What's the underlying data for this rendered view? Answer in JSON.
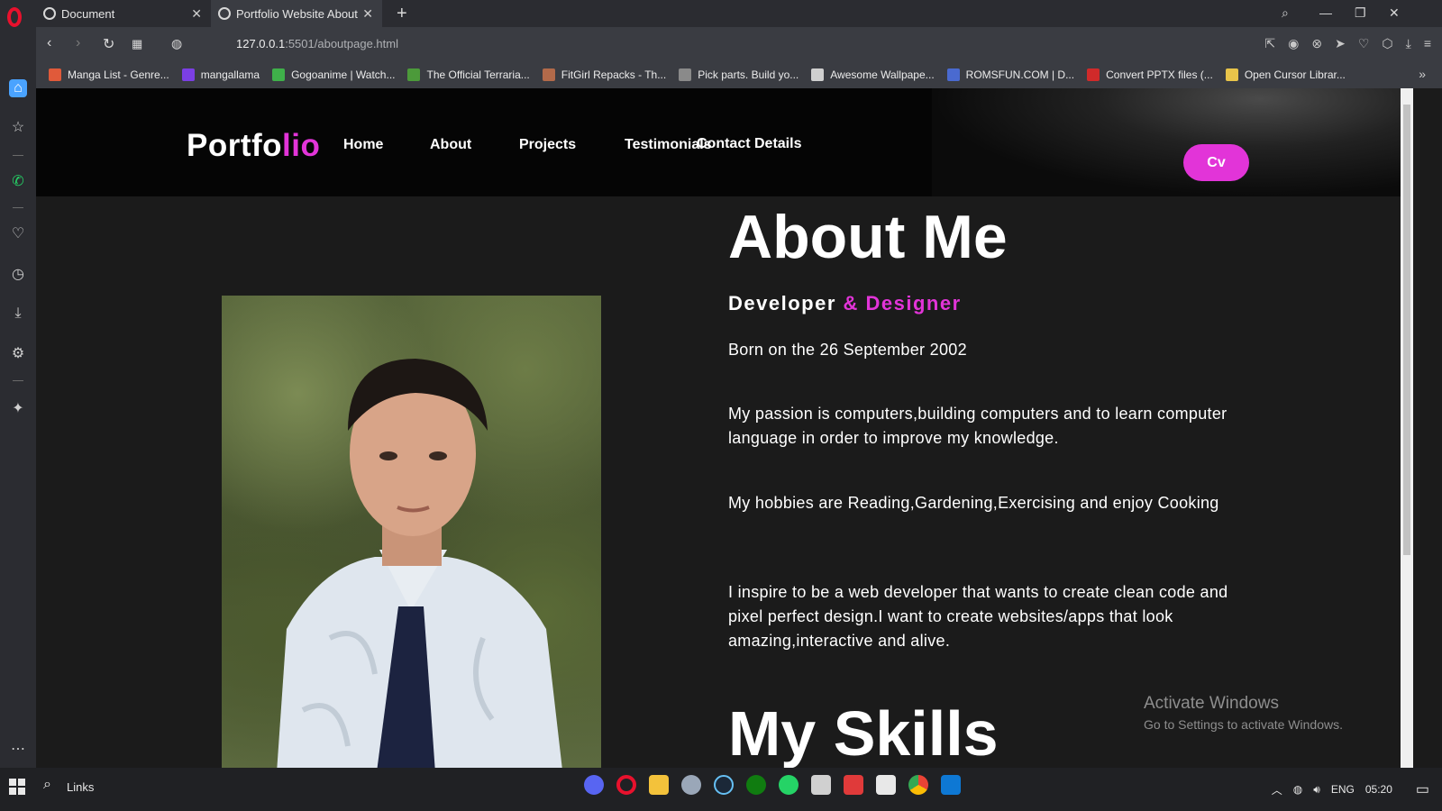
{
  "browser": {
    "tabs": [
      {
        "title": "Document",
        "active": false
      },
      {
        "title": "Portfolio Website About",
        "active": true
      }
    ],
    "url_host": "127.0.0.1",
    "url_path": ":5501/aboutpage.html",
    "bookmarks": [
      {
        "label": "Manga List - Genre...",
        "icon": "manga-icon",
        "color": "#e05a3a"
      },
      {
        "label": "mangallama",
        "icon": "m-icon",
        "color": "#7b3fe4"
      },
      {
        "label": "Gogoanime | Watch...",
        "icon": "tv-icon",
        "color": "#3fb04a"
      },
      {
        "label": "The Official Terraria...",
        "icon": "terraria-icon",
        "color": "#4c9a3a"
      },
      {
        "label": "FitGirl Repacks - Th...",
        "icon": "fitgirl-icon",
        "color": "#b26a4a"
      },
      {
        "label": "Pick parts. Build yo...",
        "icon": "pcpartpicker-icon",
        "color": "#8a8a8a"
      },
      {
        "label": "Awesome Wallpape...",
        "icon": "wallpaper-icon",
        "color": "#cfcfcf"
      },
      {
        "label": "ROMSFUN.COM | D...",
        "icon": "romsfun-icon",
        "color": "#4a6ad0"
      },
      {
        "label": "Convert PPTX files (...",
        "icon": "pdf-icon",
        "color": "#d02a2a"
      },
      {
        "label": "Open Cursor Librar...",
        "icon": "cursor-icon",
        "color": "#e8c44a"
      }
    ]
  },
  "site": {
    "logo_main": "Portfo",
    "logo_accent": "lio",
    "nav": [
      "Home",
      "About",
      "Projects",
      "Testimonials",
      "Contact Details"
    ],
    "cv_label": "Cv",
    "about_title": "About Me",
    "subtitle_main": "Developer",
    "subtitle_accent": "& Designer",
    "paragraphs": [
      "Born on the 26 September 2002",
      "My passion is computers,building computers and to learn computer language in order to improve my knowledge.",
      "My hobbies are Reading,Gardening,Exercising and enjoy Cooking",
      "I inspire to be a web developer that wants to create clean code and pixel perfect design.I want to create websites/apps that look amazing,interactive and alive."
    ],
    "skills_title": "My Skills",
    "accent_color": "#e234d8"
  },
  "watermark": {
    "line1": "Activate Windows",
    "line2": "Go to Settings to activate Windows."
  },
  "taskbar": {
    "search_label": "Links",
    "lang": "ENG",
    "time": "05:20"
  }
}
